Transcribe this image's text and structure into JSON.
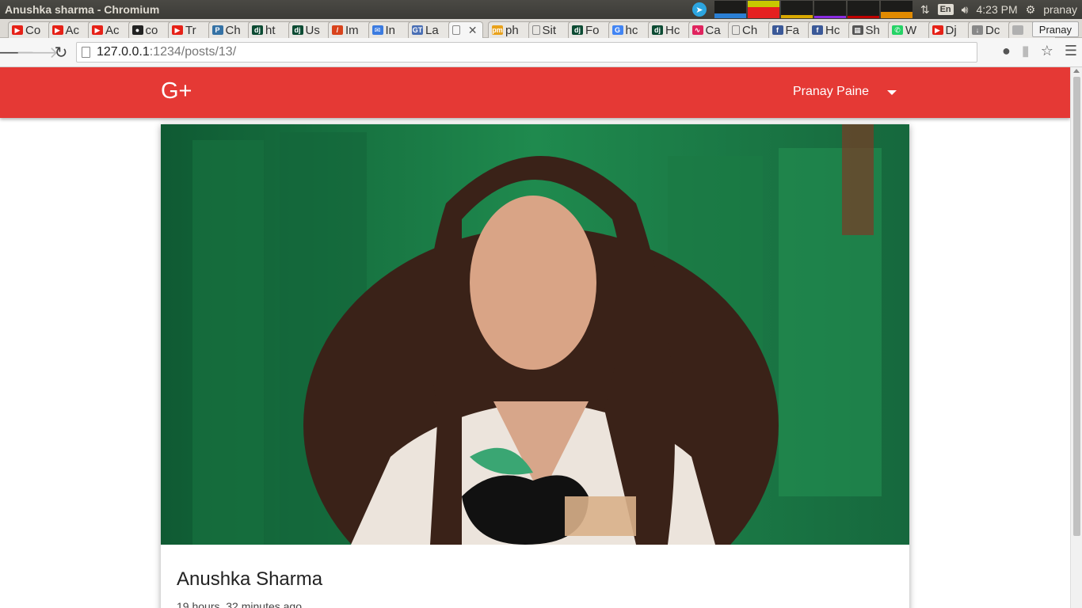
{
  "os": {
    "window_title": "Anushka sharma - Chromium",
    "keyboard_layout": "En",
    "time": "4:23 PM",
    "user": "pranay"
  },
  "tabs": [
    {
      "label": "Co",
      "icon": "youtube-icon",
      "color": "#e62117"
    },
    {
      "label": "Ac",
      "icon": "youtube-icon",
      "color": "#e62117"
    },
    {
      "label": "Ac",
      "icon": "youtube-icon",
      "color": "#e62117"
    },
    {
      "label": "co",
      "icon": "github-icon",
      "color": "#222222"
    },
    {
      "label": "Tr",
      "icon": "youtube-icon",
      "color": "#e62117"
    },
    {
      "label": "Ch",
      "icon": "python-icon",
      "color": "#3572a5"
    },
    {
      "label": "ht",
      "icon": "django-icon",
      "color": "#0c4b33"
    },
    {
      "label": "Us",
      "icon": "django-icon",
      "color": "#0c4b33"
    },
    {
      "label": "Im",
      "icon": "slash-icon",
      "color": "#d9431c"
    },
    {
      "label": "In",
      "icon": "mail-icon",
      "color": "#3b7be0"
    },
    {
      "label": "La",
      "icon": "gt-icon",
      "color": "#4a6fb5"
    },
    {
      "label": "",
      "icon": "page-icon",
      "color": "#888888",
      "active": true
    },
    {
      "label": "ph",
      "icon": "pma-icon",
      "color": "#e9a21c"
    },
    {
      "label": "Sit",
      "icon": "page-icon",
      "color": "#888888"
    },
    {
      "label": "Fo",
      "icon": "django-icon",
      "color": "#0c4b33"
    },
    {
      "label": "hc",
      "icon": "google-icon",
      "color": "#4285f4"
    },
    {
      "label": "Hc",
      "icon": "django-icon",
      "color": "#0c4b33"
    },
    {
      "label": "Ca",
      "icon": "wave-icon",
      "color": "#e0245e"
    },
    {
      "label": "Ch",
      "icon": "page-icon",
      "color": "#888888"
    },
    {
      "label": "Fa",
      "icon": "facebook-icon",
      "color": "#3b5998"
    },
    {
      "label": "Hc",
      "icon": "facebook-icon",
      "color": "#3b5998"
    },
    {
      "label": "Sh",
      "icon": "grid-icon",
      "color": "#555555"
    },
    {
      "label": "W",
      "icon": "whatsapp-icon",
      "color": "#25d366"
    },
    {
      "label": "Dj",
      "icon": "youtube-icon",
      "color": "#e62117"
    },
    {
      "label": "Dc",
      "icon": "download-icon",
      "color": "#888888"
    },
    {
      "label": "",
      "icon": "blank-icon",
      "color": "#b0b0b0"
    }
  ],
  "profile_button": "Pranay",
  "omnibox": {
    "host": "127.0.0.1",
    "rest": ":1234/posts/13/"
  },
  "app": {
    "brand": "G+",
    "user_name": "Pranay Paine",
    "accent": "#e53935"
  },
  "post": {
    "title": "Anushka Sharma",
    "time_ago": "19 hours, 32 minutes ago"
  }
}
